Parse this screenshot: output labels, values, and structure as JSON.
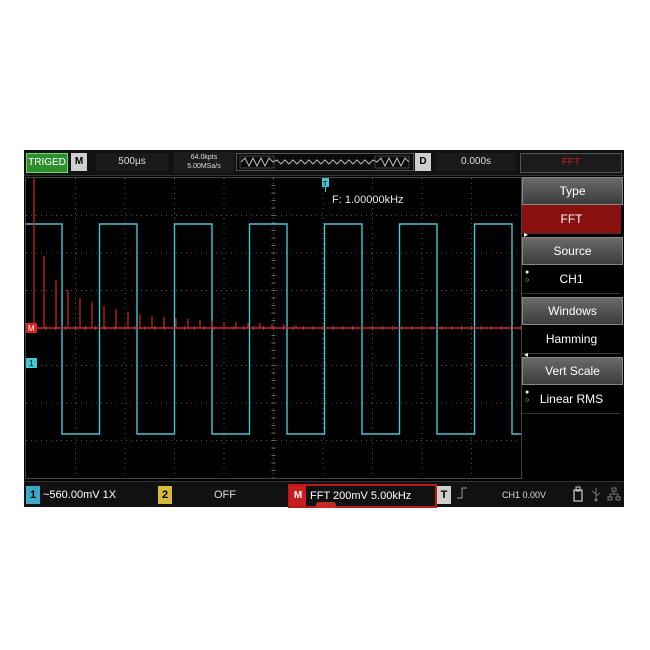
{
  "header": {
    "trig_status": "TRIGED",
    "mode_button": "M",
    "timebase": "500µs",
    "mem_depth": "64.0kpts",
    "sample_rate": "5.00MSa/s",
    "delay_button": "D",
    "delay_value": "0.000s",
    "function_label": "FFT"
  },
  "display": {
    "freq_readout": "F: 1.00000kHz",
    "ch1_marker": "1",
    "math_marker": "M",
    "trig_marker": "T"
  },
  "menu": {
    "type_label": "Type",
    "type_value": "FFT",
    "source_label": "Source",
    "source_value": "CH1",
    "windows_label": "Windows",
    "windows_value": "Hamming",
    "vert_label": "Vert Scale",
    "vert_value": "Linear RMS"
  },
  "footer": {
    "ch1_num": "1",
    "ch1_info": "~560.00mV 1X",
    "ch2_num": "2",
    "ch2_info": "OFF",
    "math_num": "M",
    "math_info": "FFT 200mV 5.00kHz",
    "trig_num": "T",
    "trig_source": "CH1 0.00V"
  },
  "icons": [
    "usb-storage-icon",
    "usb-icon",
    "network-icon"
  ],
  "colors": {
    "ch1": "#3fc8d6",
    "math": "#d82323",
    "trig_green": "#2f8f2f"
  }
}
